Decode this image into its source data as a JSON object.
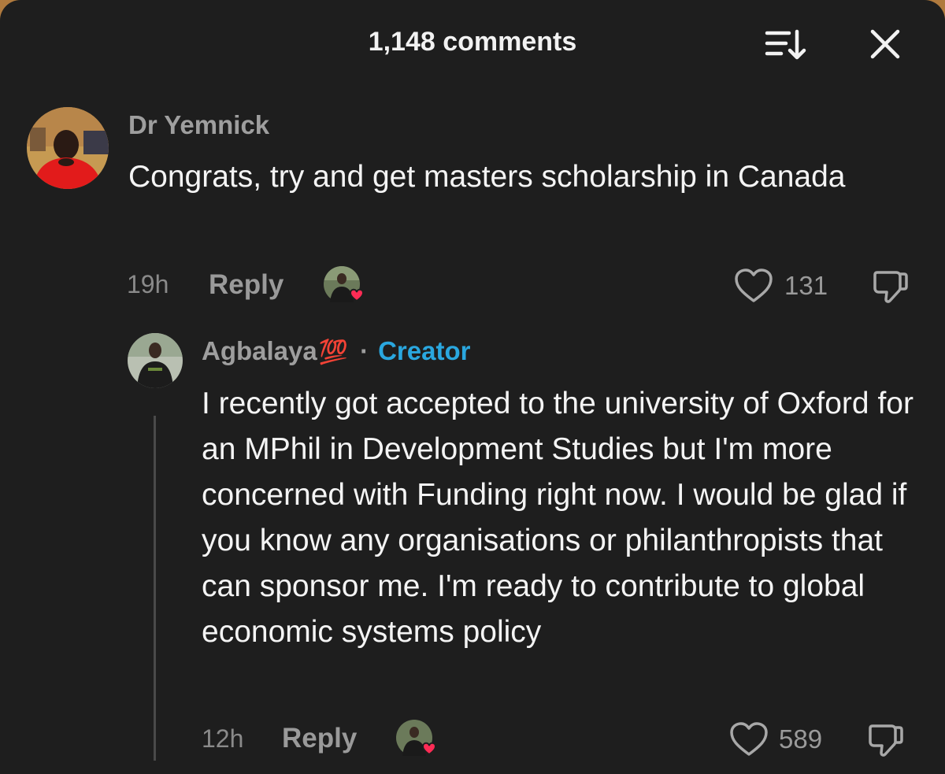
{
  "header": {
    "comment_count": "1,148 comments",
    "sort_icon": "sort-descending-icon",
    "close_icon": "close-icon"
  },
  "comments": [
    {
      "username": "Dr Yemnick",
      "text": "Congrats, try and get masters scholarship in Canada",
      "time": "19h",
      "reply_label": "Reply",
      "likes": "131",
      "liked_by_creator": true
    }
  ],
  "replies": [
    {
      "username": "Agbalaya",
      "emoji": "💯",
      "separator": "·",
      "badge": "Creator",
      "text": "I recently got accepted to the university of Oxford for an MPhil in Development Studies but I'm more concerned with Funding right now. I would be glad if you know any organisations or philanthropists that can sponsor me. I'm ready to contribute to global economic systems policy",
      "time": "12h",
      "reply_label": "Reply",
      "likes": "589",
      "liked_by_creator": true
    }
  ],
  "colors": {
    "background": "#1e1e1e",
    "creator_badge": "#2aa7df",
    "heart_badge": "#fe2c55",
    "text_primary": "#f4f4f4",
    "text_secondary": "#9a9a9a"
  }
}
